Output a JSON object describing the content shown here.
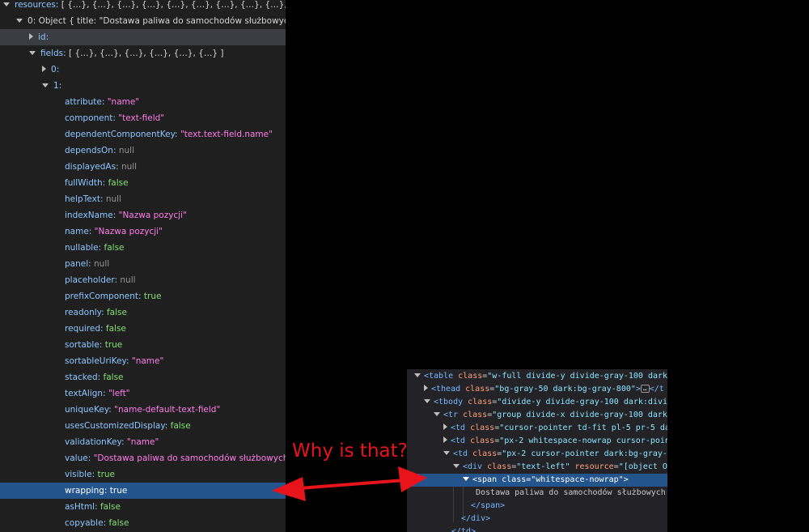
{
  "object_tree": {
    "rows": [
      {
        "indent": 0,
        "tri": "down",
        "key": "resources",
        "sep": ": ",
        "value": "[ {…}, {…}, {…}, {…}, {…}, {…}, {…}, {…}, {…}, … ]",
        "vtype": "p"
      },
      {
        "indent": 1,
        "tri": "down",
        "key": "0",
        "sep": ": ",
        "value": "Object { title: \"Dostawa paliwa do samochodów służbowych\"",
        "vtype": "p",
        "key_plain": true
      },
      {
        "indent": 2,
        "tri": "right",
        "key": "id",
        "sep": ":",
        "value": "",
        "vtype": "p",
        "highlight": "gray"
      },
      {
        "indent": 2,
        "tri": "down",
        "key": "fields",
        "sep": ": ",
        "value": "[ {…}, {…}, {…}, {…}, {…}, {…} ]",
        "vtype": "p"
      },
      {
        "indent": 3,
        "tri": "right",
        "key": "0",
        "sep": ":",
        "value": "",
        "vtype": "p"
      },
      {
        "indent": 3,
        "tri": "down",
        "key": "1",
        "sep": ":",
        "value": "",
        "vtype": "p"
      },
      {
        "indent": 4,
        "key": "attribute",
        "sep": ": ",
        "value": "\"name\"",
        "vtype": "s"
      },
      {
        "indent": 4,
        "key": "component",
        "sep": ": ",
        "value": "\"text-field\"",
        "vtype": "s"
      },
      {
        "indent": 4,
        "key": "dependentComponentKey",
        "sep": ": ",
        "value": "\"text.text-field.name\"",
        "vtype": "s"
      },
      {
        "indent": 4,
        "key": "dependsOn",
        "sep": ": ",
        "value": "null",
        "vtype": "n"
      },
      {
        "indent": 4,
        "key": "displayedAs",
        "sep": ": ",
        "value": "null",
        "vtype": "n"
      },
      {
        "indent": 4,
        "key": "fullWidth",
        "sep": ": ",
        "value": "false",
        "vtype": "b"
      },
      {
        "indent": 4,
        "key": "helpText",
        "sep": ": ",
        "value": "null",
        "vtype": "n"
      },
      {
        "indent": 4,
        "key": "indexName",
        "sep": ": ",
        "value": "\"Nazwa pozycji\"",
        "vtype": "s"
      },
      {
        "indent": 4,
        "key": "name",
        "sep": ": ",
        "value": "\"Nazwa pozycji\"",
        "vtype": "s"
      },
      {
        "indent": 4,
        "key": "nullable",
        "sep": ": ",
        "value": "false",
        "vtype": "b"
      },
      {
        "indent": 4,
        "key": "panel",
        "sep": ": ",
        "value": "null",
        "vtype": "n"
      },
      {
        "indent": 4,
        "key": "placeholder",
        "sep": ": ",
        "value": "null",
        "vtype": "n"
      },
      {
        "indent": 4,
        "key": "prefixComponent",
        "sep": ": ",
        "value": "true",
        "vtype": "b"
      },
      {
        "indent": 4,
        "key": "readonly",
        "sep": ": ",
        "value": "false",
        "vtype": "b"
      },
      {
        "indent": 4,
        "key": "required",
        "sep": ": ",
        "value": "false",
        "vtype": "b"
      },
      {
        "indent": 4,
        "key": "sortable",
        "sep": ": ",
        "value": "true",
        "vtype": "b"
      },
      {
        "indent": 4,
        "key": "sortableUriKey",
        "sep": ": ",
        "value": "\"name\"",
        "vtype": "s"
      },
      {
        "indent": 4,
        "key": "stacked",
        "sep": ": ",
        "value": "false",
        "vtype": "b"
      },
      {
        "indent": 4,
        "key": "textAlign",
        "sep": ": ",
        "value": "\"left\"",
        "vtype": "s"
      },
      {
        "indent": 4,
        "key": "uniqueKey",
        "sep": ": ",
        "value": "\"name-default-text-field\"",
        "vtype": "s"
      },
      {
        "indent": 4,
        "key": "usesCustomizedDisplay",
        "sep": ": ",
        "value": "false",
        "vtype": "b"
      },
      {
        "indent": 4,
        "key": "validationKey",
        "sep": ": ",
        "value": "\"name\"",
        "vtype": "s"
      },
      {
        "indent": 4,
        "key": "value",
        "sep": ": ",
        "value": "\"Dostawa paliwa do samochodów służbowych\"",
        "vtype": "s"
      },
      {
        "indent": 4,
        "key": "visible",
        "sep": ": ",
        "value": "true",
        "vtype": "b"
      },
      {
        "indent": 4,
        "key": "wrapping",
        "sep": ": ",
        "value": "true",
        "vtype": "b",
        "highlight": "blue"
      },
      {
        "indent": 4,
        "key": "asHtml",
        "sep": ": ",
        "value": "false",
        "vtype": "b"
      },
      {
        "indent": 4,
        "key": "copyable",
        "sep": ": ",
        "value": "false",
        "vtype": "b"
      }
    ]
  },
  "inspector": {
    "rows": [
      {
        "indent": 0,
        "tri": "down",
        "kind": "open",
        "tag": "table",
        "attrs": [
          {
            "n": "class",
            "v": "w-full divide-y divide-gray-100 dark"
          }
        ],
        "tail": ""
      },
      {
        "indent": 1,
        "tri": "right",
        "kind": "open",
        "tag": "thead",
        "attrs": [
          {
            "n": "class",
            "v": "bg-gray-50 dark:bg-gray-800"
          }
        ],
        "tail": ">",
        "ellipsis": "…",
        "close": "</t"
      },
      {
        "indent": 1,
        "tri": "down",
        "kind": "open",
        "tag": "tbody",
        "attrs": [
          {
            "n": "class",
            "v": "divide-y divide-gray-100 dark:divi"
          }
        ],
        "tail": ""
      },
      {
        "indent": 2,
        "tri": "down",
        "kind": "open",
        "tag": "tr",
        "attrs": [
          {
            "n": "class",
            "v": "group divide-x divide-gray-100 dark:"
          }
        ],
        "tail": ""
      },
      {
        "indent": 3,
        "tri": "right",
        "kind": "open",
        "tag": "td",
        "attrs": [
          {
            "n": "class",
            "v": "cursor-pointer td-fit pl-5 pr-5 da"
          }
        ],
        "tail": ""
      },
      {
        "indent": 3,
        "tri": "right",
        "kind": "open",
        "tag": "td",
        "attrs": [
          {
            "n": "class",
            "v": "px-2 whitespace-nowrap cursor-poin"
          }
        ],
        "tail": ""
      },
      {
        "indent": 3,
        "tri": "down",
        "kind": "open",
        "tag": "td",
        "attrs": [
          {
            "n": "class",
            "v": "px-2 cursor-pointer dark:bg-gray-8"
          }
        ],
        "tail": ""
      },
      {
        "indent": 4,
        "tri": "down",
        "kind": "open",
        "tag": "div",
        "attrs": [
          {
            "n": "class",
            "v": "text-left"
          },
          {
            "n": "resource",
            "v": "[object Ob"
          }
        ],
        "tail": ""
      },
      {
        "indent": 5,
        "tri": "down",
        "kind": "open",
        "tag": "span",
        "attrs": [
          {
            "n": "class",
            "v": "whitespace-nowrap"
          }
        ],
        "tail": ">",
        "selected": true
      },
      {
        "indent": 6,
        "kind": "text",
        "text": "Dostawa paliwa do samochodów służbowych"
      },
      {
        "indent": 5,
        "kind": "close",
        "tag": "span"
      },
      {
        "indent": 4,
        "kind": "close",
        "tag": "div"
      },
      {
        "indent": 3,
        "kind": "close",
        "tag": "td"
      }
    ]
  },
  "annotation": {
    "text": "Why is that?",
    "color": "#e8141b"
  },
  "colors": {
    "key": "#8ec6ff",
    "string": "#ff7de9",
    "boolean": "#86de74",
    "null": "#939395",
    "selection": "#23548c",
    "tag": "#76b6ff",
    "attr_name": "#ff9f7a",
    "attr_value": "#8be4ff"
  }
}
